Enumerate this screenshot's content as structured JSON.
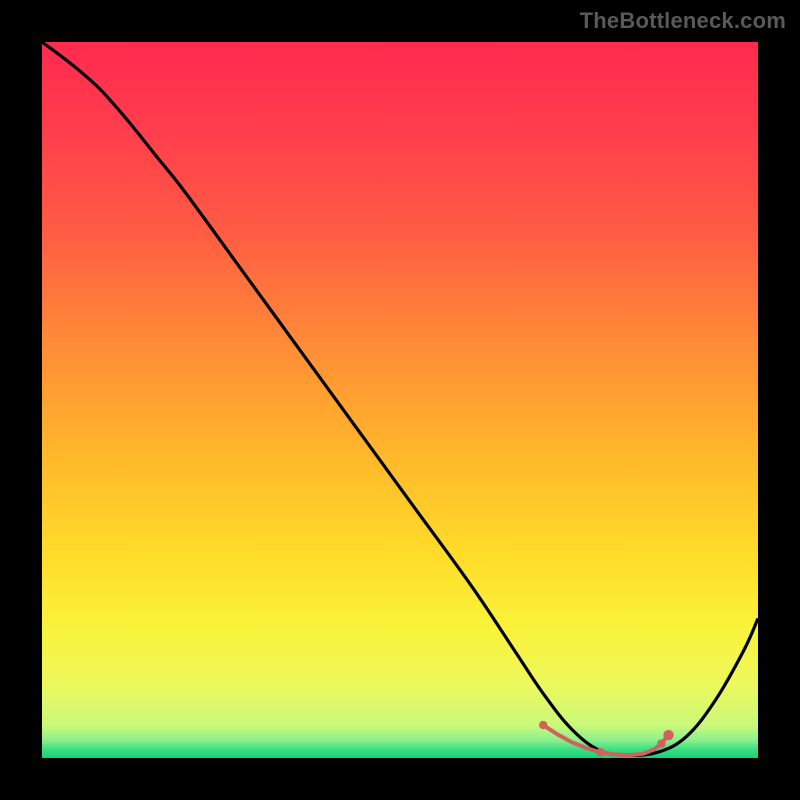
{
  "watermark": "TheBottleneck.com",
  "colors": {
    "frame_border": "#000000",
    "curve": "#000000",
    "dots": "#d2605c",
    "gradient_stops": [
      {
        "pos": 0.0,
        "color": "#ff2a4f"
      },
      {
        "pos": 0.12,
        "color": "#ff3d4c"
      },
      {
        "pos": 0.26,
        "color": "#ff5a44"
      },
      {
        "pos": 0.42,
        "color": "#ff8b36"
      },
      {
        "pos": 0.58,
        "color": "#ffb82a"
      },
      {
        "pos": 0.72,
        "color": "#ffdd2a"
      },
      {
        "pos": 0.82,
        "color": "#f9f33a"
      },
      {
        "pos": 0.9,
        "color": "#ecf85e"
      },
      {
        "pos": 0.955,
        "color": "#c9f97a"
      },
      {
        "pos": 0.975,
        "color": "#8df08c"
      },
      {
        "pos": 0.988,
        "color": "#3adf84"
      },
      {
        "pos": 1.0,
        "color": "#17d07a"
      }
    ]
  },
  "chart_data": {
    "type": "line",
    "title": "",
    "xlabel": "",
    "ylabel": "",
    "xlim": [
      0,
      1
    ],
    "ylim": [
      0,
      1
    ],
    "grid": false,
    "series": [
      {
        "name": "bottleneck-curve",
        "x": [
          0.0,
          0.04,
          0.08,
          0.12,
          0.16,
          0.2,
          0.28,
          0.36,
          0.44,
          0.52,
          0.6,
          0.66,
          0.7,
          0.74,
          0.78,
          0.82,
          0.86,
          0.9,
          0.94,
          0.98,
          1.0
        ],
        "y": [
          1.0,
          0.97,
          0.935,
          0.89,
          0.84,
          0.79,
          0.68,
          0.57,
          0.46,
          0.35,
          0.24,
          0.15,
          0.09,
          0.04,
          0.01,
          0.004,
          0.008,
          0.03,
          0.08,
          0.15,
          0.195
        ]
      },
      {
        "name": "highlight-dots",
        "x": [
          0.7,
          0.72,
          0.74,
          0.76,
          0.78,
          0.8,
          0.82,
          0.84,
          0.855,
          0.865,
          0.875
        ],
        "y": [
          0.046,
          0.033,
          0.022,
          0.014,
          0.008,
          0.005,
          0.004,
          0.006,
          0.012,
          0.02,
          0.032
        ]
      }
    ]
  }
}
